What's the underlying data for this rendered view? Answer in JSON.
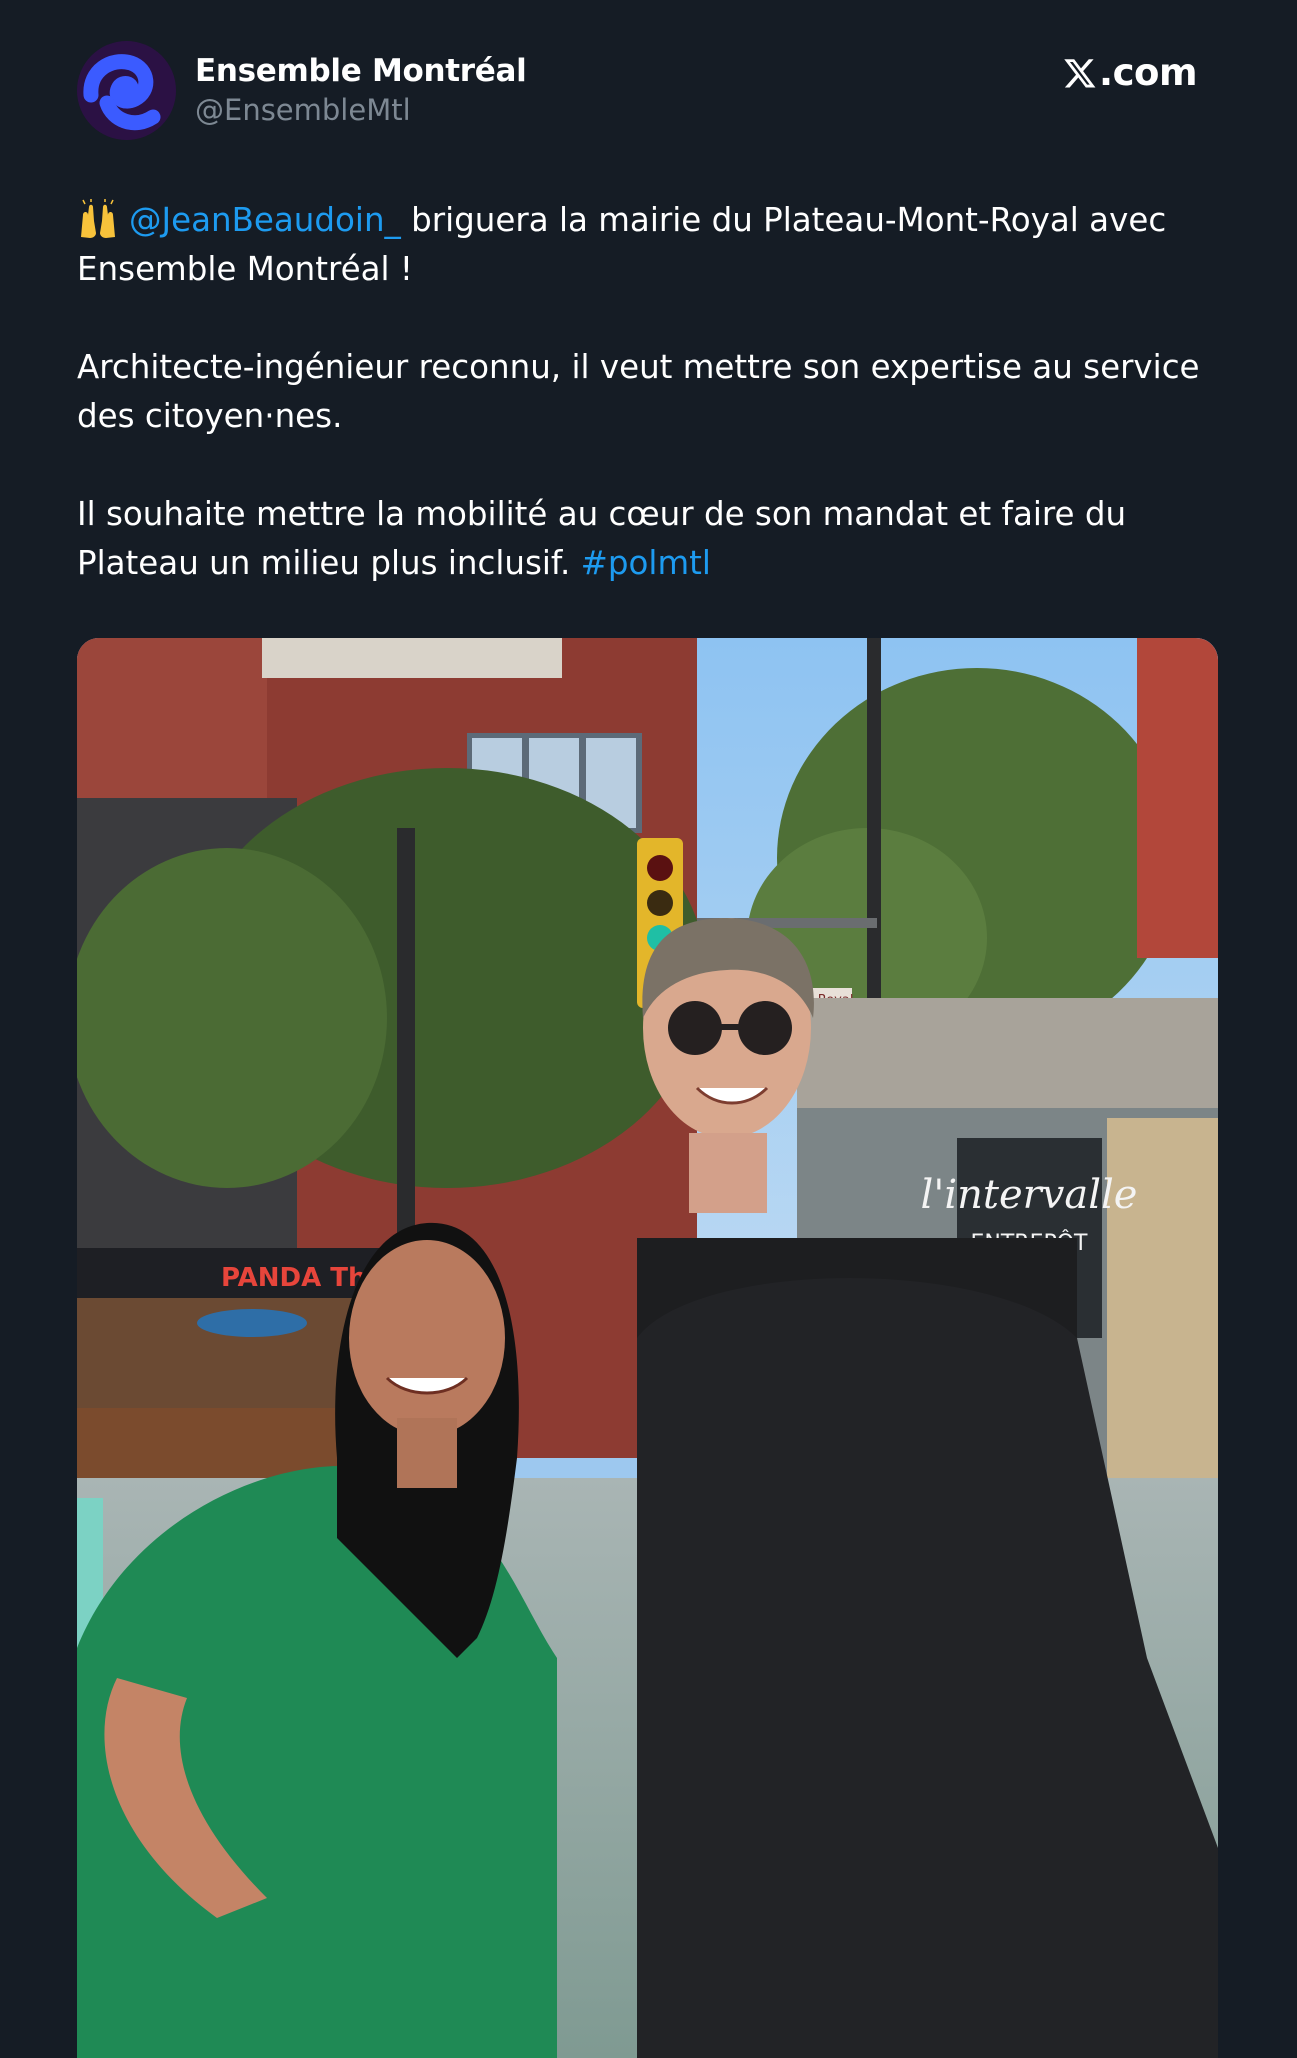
{
  "author": {
    "display_name": "Ensemble Montréal",
    "handle": "@EnsembleMtl",
    "avatar_icon": "ensemble-montreal-logo-icon"
  },
  "brand": {
    "icon": "x-logo-icon",
    "label": ".com"
  },
  "tweet": {
    "line1_emoji": "raising-hands-emoji",
    "mention": "@JeanBeaudoin_",
    "line1_text": " briguera la mairie du Plateau-Mont-Royal avec Ensemble Montréal !",
    "paragraph2": "Architecte-ingénieur reconnu, il veut mettre son expertise au service des citoyen·nes.",
    "paragraph3_text": "Il souhaite mettre la mobilité au cœur de son mandat et faire du Plateau un milieu plus inclusif. ",
    "hashtag": "#polmtl"
  },
  "media": {
    "description_icon": "photo-two-people-street",
    "signs": {
      "restaurant": "PANDA Thai",
      "street": "Mont-Royal",
      "store_script": "l'intervalle",
      "store_sub": "ENTREPÔT"
    }
  },
  "colors": {
    "background": "#151c25",
    "link": "#1d9bf0",
    "handle_gray": "#7d8893"
  }
}
